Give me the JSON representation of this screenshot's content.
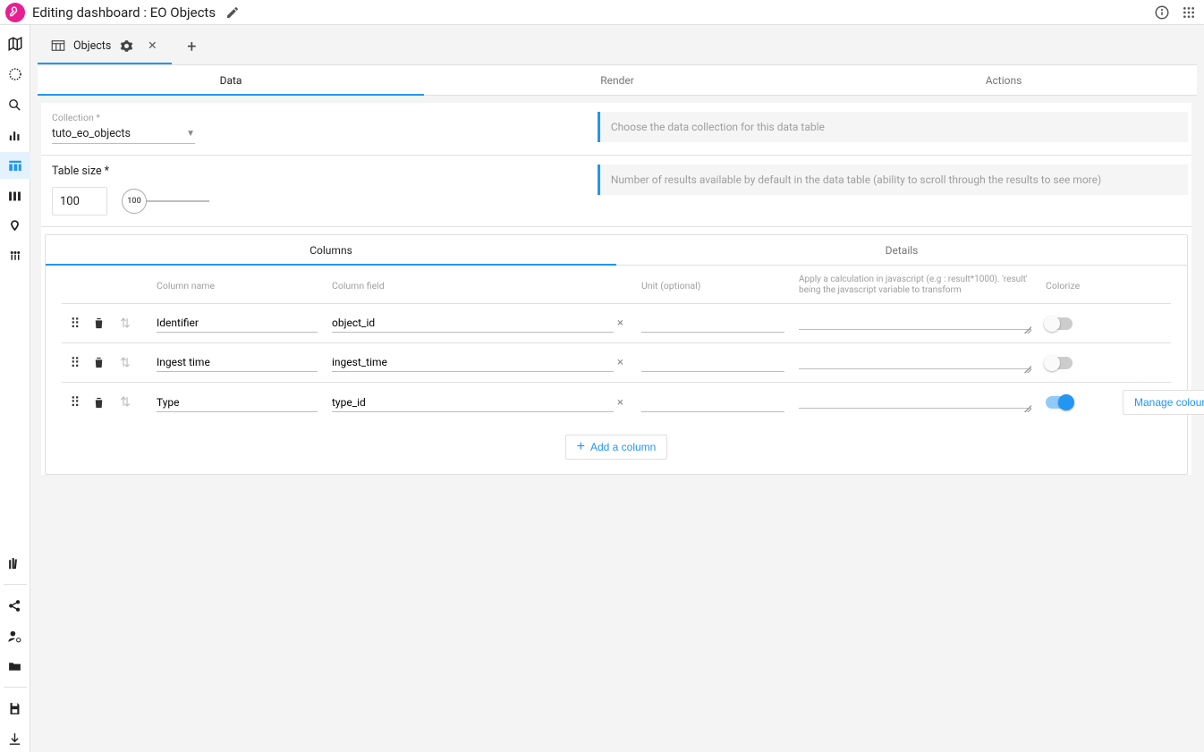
{
  "header": {
    "title_prefix": "Editing dashboard : ",
    "title_name": "EO Objects"
  },
  "sidebar": {
    "items": [
      {
        "name": "map-icon"
      },
      {
        "name": "timeline-icon"
      },
      {
        "name": "search-icon"
      },
      {
        "name": "metrics-icon"
      },
      {
        "name": "datatable-icon",
        "active": true
      },
      {
        "name": "grid-icon"
      },
      {
        "name": "swimlane-icon"
      },
      {
        "name": "people-icon"
      }
    ],
    "bottom_items": [
      {
        "name": "library-icon"
      },
      {
        "name": "share-icon"
      },
      {
        "name": "user-settings-icon"
      },
      {
        "name": "folder-icon"
      },
      {
        "name": "save-icon"
      },
      {
        "name": "download-icon"
      }
    ]
  },
  "tabs": {
    "items": [
      {
        "label": "Objects",
        "has_settings": true,
        "has_close": true
      }
    ]
  },
  "subtabs": [
    "Data",
    "Render",
    "Actions"
  ],
  "active_subtab": 0,
  "collection": {
    "label": "Collection *",
    "value": "tuto_eo_objects",
    "hint": "Choose the data collection for this data table"
  },
  "table_size": {
    "label": "Table size *",
    "value": "100",
    "slider_value": "100",
    "hint": "Number of results available by default in the data table (ability to scroll through the results to see more)"
  },
  "columns_tabs": [
    "Columns",
    "Details"
  ],
  "columns_active": 0,
  "columns_head": {
    "name": "Column name",
    "field": "Column field",
    "unit": "Unit (optional)",
    "calc": "Apply a calculation in javascript (e.g : result*1000). 'result' being the javascript variable to transform",
    "colorize": "Colorize"
  },
  "columns": [
    {
      "name": "Identifier",
      "field": "object_id",
      "unit": "",
      "calc": "",
      "colorize": false
    },
    {
      "name": "Ingest time",
      "field": "ingest_time",
      "unit": "",
      "calc": "",
      "colorize": false
    },
    {
      "name": "Type",
      "field": "type_id",
      "unit": "",
      "calc": "",
      "colorize": true
    }
  ],
  "buttons": {
    "manage_colours": "Manage colours",
    "add_column": "Add a column"
  }
}
